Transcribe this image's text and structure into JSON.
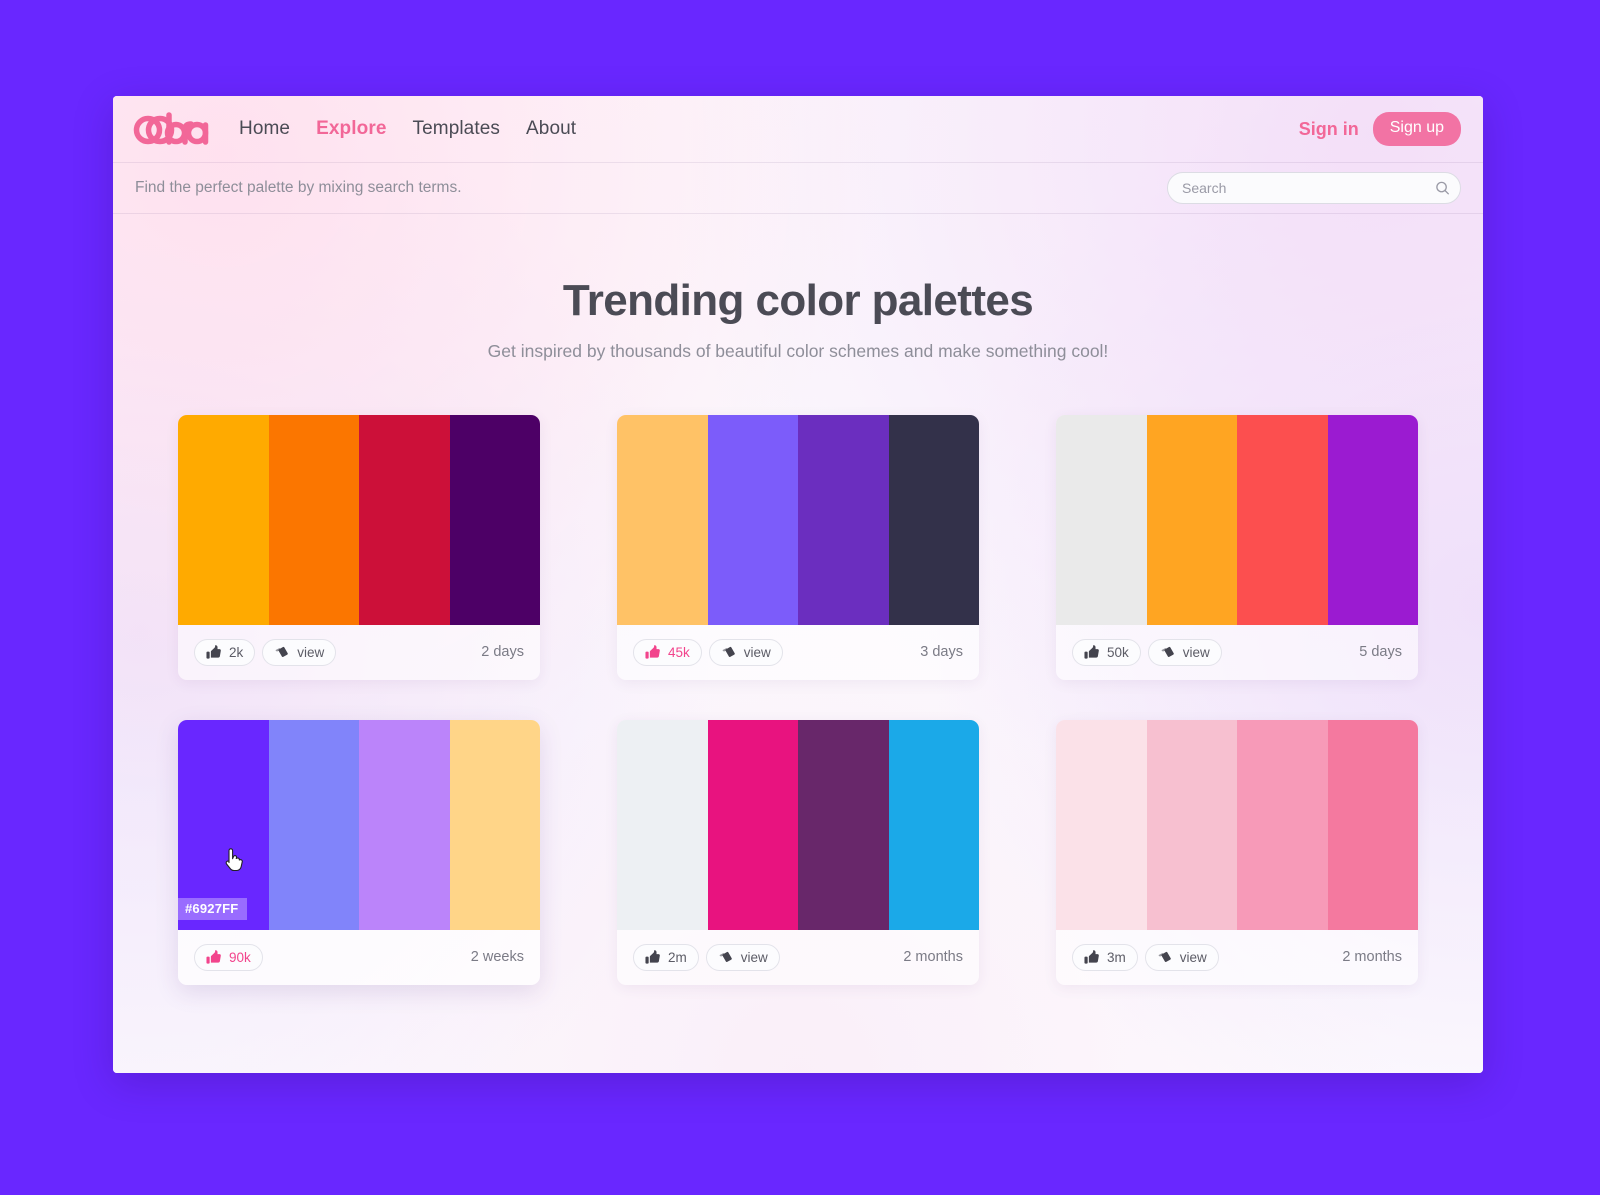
{
  "page": {
    "background_color": "#6927FF"
  },
  "nav": {
    "logo_text": "cobra",
    "links": [
      {
        "label": "Home",
        "active": false
      },
      {
        "label": "Explore",
        "active": true
      },
      {
        "label": "Templates",
        "active": false
      },
      {
        "label": "About",
        "active": false
      }
    ],
    "sign_in_label": "Sign in",
    "sign_up_label": "Sign up",
    "accent_color": "#F26798"
  },
  "subbar": {
    "tagline": "Find the perfect palette by mixing search terms.",
    "search": {
      "value": "",
      "placeholder": "Search",
      "icon": "search-icon"
    }
  },
  "hero": {
    "title": "Trending color palettes",
    "subtitle": "Get inspired by thousands of beautiful color schemes and make something cool!"
  },
  "cards": [
    {
      "id": "palette-1",
      "colors": [
        "#FFAA00",
        "#FB7600",
        "#CC1039",
        "#4D0066"
      ],
      "likes": "2k",
      "liked": false,
      "view_label": "view",
      "has_view": true,
      "time": "2 days",
      "hovered": false,
      "hex_tooltip": null
    },
    {
      "id": "palette-2",
      "colors": [
        "#FFC266",
        "#7C5CFA",
        "#6B2EBF",
        "#33314A"
      ],
      "likes": "45k",
      "liked": true,
      "view_label": "view",
      "has_view": true,
      "time": "3 days",
      "hovered": false,
      "hex_tooltip": null
    },
    {
      "id": "palette-3",
      "colors": [
        "#EAEAEA",
        "#FFA522",
        "#FC4F4F",
        "#9B1BD1"
      ],
      "likes": "50k",
      "liked": false,
      "view_label": "view",
      "has_view": true,
      "time": "5 days",
      "hovered": false,
      "hex_tooltip": null
    },
    {
      "id": "palette-4",
      "colors": [
        "#6927FF",
        "#8184FA",
        "#BB84FA",
        "#FFD588"
      ],
      "likes": "90k",
      "liked": true,
      "view_label": "view",
      "has_view": false,
      "time": "2 weeks",
      "hovered": true,
      "hex_tooltip": "#6927FF"
    },
    {
      "id": "palette-5",
      "colors": [
        "#EDF0F3",
        "#E8137F",
        "#68276A",
        "#1BA9E8"
      ],
      "likes": "2m",
      "liked": false,
      "view_label": "view",
      "has_view": true,
      "time": "2 months",
      "hovered": false,
      "hex_tooltip": null
    },
    {
      "id": "palette-6",
      "colors": [
        "#FBE1E8",
        "#F7C0D0",
        "#F79AB8",
        "#F4799F"
      ],
      "likes": "3m",
      "liked": false,
      "view_label": "view",
      "has_view": true,
      "time": "2 months",
      "hovered": false,
      "hex_tooltip": null
    }
  ]
}
